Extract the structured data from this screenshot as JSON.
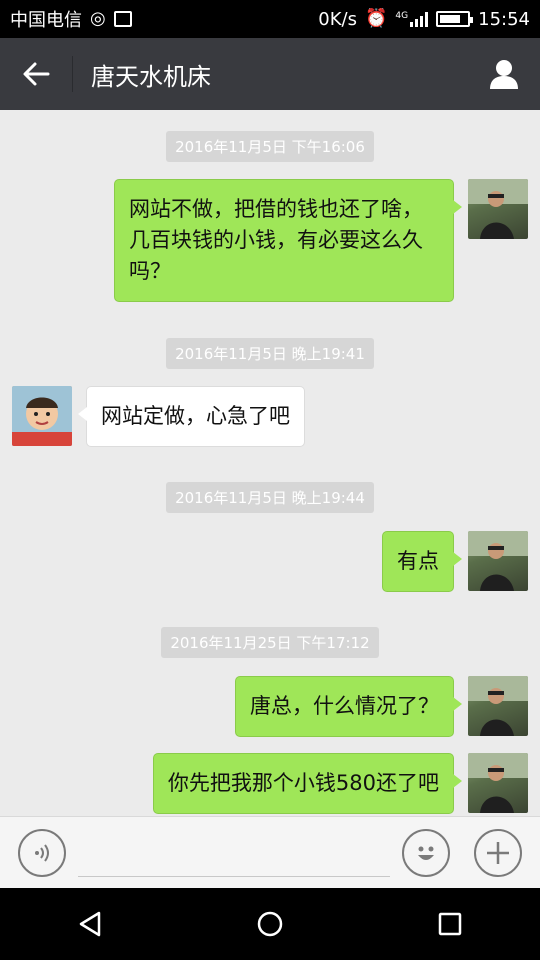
{
  "status_bar": {
    "carrier": "中国电信",
    "speed": "0K/s",
    "net_type": "4G",
    "time": "15:54"
  },
  "header": {
    "title": "唐天水机床"
  },
  "messages": [
    {
      "type": "time",
      "text": "2016年11月5日 下午16:06"
    },
    {
      "type": "out",
      "text": "网站不做，把借的钱也还了啥，几百块钱的小钱，有必要这么久吗？"
    },
    {
      "type": "time",
      "text": "2016年11月5日 晚上19:41"
    },
    {
      "type": "in",
      "text": "网站定做，心急了吧"
    },
    {
      "type": "time",
      "text": "2016年11月5日 晚上19:44"
    },
    {
      "type": "out",
      "text": "有点"
    },
    {
      "type": "time",
      "text": "2016年11月25日 下午17:12"
    },
    {
      "type": "out",
      "text": "唐总，什么情况了？"
    },
    {
      "type": "out",
      "text": "你先把我那个小钱580还了吧"
    }
  ],
  "input": {
    "value": "",
    "placeholder": ""
  },
  "colors": {
    "header_bg": "#393a3f",
    "outgoing_bubble": "#9fe658",
    "incoming_bubble": "#ffffff",
    "chat_bg": "#ebebeb"
  },
  "icons": {
    "back": "arrow-left-icon",
    "profile": "person-icon",
    "voice": "voice-icon",
    "emoji": "smiley-icon",
    "more": "plus-icon"
  }
}
